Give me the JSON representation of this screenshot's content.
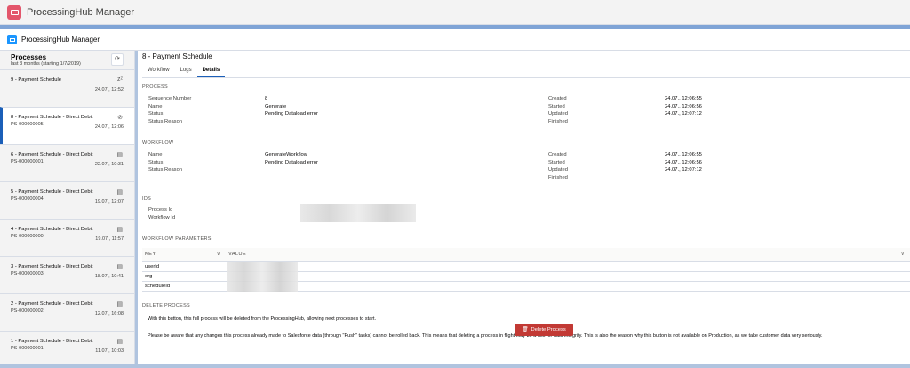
{
  "app": {
    "title": "ProcessingHub Manager",
    "subtitle": "ProcessingHub Manager"
  },
  "sidebar": {
    "title": "Processes",
    "subtitle": "last 3 months (starting 1/7/2019)",
    "items": [
      {
        "title": "9 - Payment Schedule",
        "id": "",
        "date": "24.07., 12:52",
        "icon": "sleep-icon"
      },
      {
        "title": "8 - Payment Schedule - Direct Debit",
        "id": "PS-000000005",
        "date": "24.07., 12:06",
        "icon": "cancel-icon",
        "selected": true
      },
      {
        "title": "6 - Payment Schedule - Direct Debit",
        "id": "PS-000000001",
        "date": "22.07., 10:31",
        "icon": "document-icon"
      },
      {
        "title": "5 - Payment Schedule - Direct Debit",
        "id": "PS-000000004",
        "date": "19.07., 12:07",
        "icon": "document-icon"
      },
      {
        "title": "4 - Payment Schedule - Direct Debit",
        "id": "PS-000000000",
        "date": "19.07., 11:57",
        "icon": "document-icon"
      },
      {
        "title": "3 - Payment Schedule - Direct Debit",
        "id": "PS-000000003",
        "date": "18.07., 10:41",
        "icon": "document-icon"
      },
      {
        "title": "2 - Payment Schedule - Direct Debit",
        "id": "PS-000000002",
        "date": "12.07., 16:08",
        "icon": "document-icon"
      },
      {
        "title": "1 - Payment Schedule - Direct Debit",
        "id": "PS-000000001",
        "date": "11.07., 10:03",
        "icon": "document-icon"
      }
    ]
  },
  "main": {
    "title": "8 - Payment Schedule",
    "tabs": [
      "Workflow",
      "Logs",
      "Details"
    ],
    "active_tab": "Details",
    "process": {
      "heading": "PROCESS",
      "fields": [
        {
          "label": "Sequence Number",
          "value": "8"
        },
        {
          "label": "Name",
          "value": "Generate"
        },
        {
          "label": "Status",
          "value": "Pending Dataload error"
        },
        {
          "label": "Status Reason",
          "value": ""
        }
      ],
      "times": [
        {
          "label": "Created",
          "value": "24.07., 12:06:55"
        },
        {
          "label": "Started",
          "value": "24.07., 12:06:56"
        },
        {
          "label": "Updated",
          "value": "24.07., 12:07:12"
        },
        {
          "label": "Finished",
          "value": ""
        }
      ]
    },
    "workflow": {
      "heading": "WORKFLOW",
      "fields": [
        {
          "label": "Name",
          "value": "GenerateWorkflow"
        },
        {
          "label": "Status",
          "value": "Pending Dataload error"
        },
        {
          "label": "Status Reason",
          "value": ""
        }
      ],
      "times": [
        {
          "label": "Created",
          "value": "24.07., 12:06:55"
        },
        {
          "label": "Started",
          "value": "24.07., 12:06:56"
        },
        {
          "label": "Updated",
          "value": "24.07., 12:07:12"
        },
        {
          "label": "Finished",
          "value": ""
        }
      ]
    },
    "ids": {
      "heading": "IDS",
      "fields": [
        {
          "label": "Process Id"
        },
        {
          "label": "Workflow Id"
        }
      ]
    },
    "params": {
      "heading": "WORKFLOW PARAMETERS",
      "columns": [
        "KEY",
        "VALUE"
      ],
      "rows": [
        {
          "key": "userId"
        },
        {
          "key": "org"
        },
        {
          "key": "scheduleId"
        }
      ]
    },
    "delete": {
      "heading": "DELETE PROCESS",
      "text1": "With this button, this full process will be deleted from the ProcessingHub, allowing next processes to start.",
      "text2": "Please be aware that any changes this process already made to Salesforce data (through \"Push\" tasks) cannot be rolled back. This means that deleting a process in flight may be a risk for data integrity. This is also the reason why this button is not available on Production, as we take customer data very seriously.",
      "button": "Delete Process",
      "button_color": "#c23934"
    }
  }
}
